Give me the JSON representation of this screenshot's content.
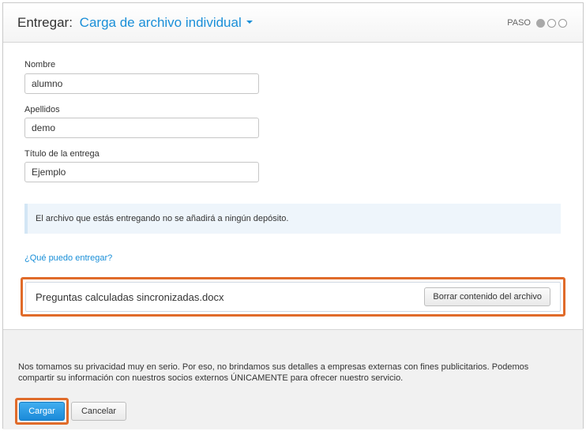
{
  "header": {
    "title_prefix": "Entregar:",
    "mode_label": "Carga de archivo individual",
    "step_label": "PASO",
    "steps_total": 3,
    "current_step": 1
  },
  "form": {
    "first_name": {
      "label": "Nombre",
      "value": "alumno"
    },
    "last_name": {
      "label": "Apellidos",
      "value": "demo"
    },
    "submission_title": {
      "label": "Título de la entrega",
      "value": "Ejemplo"
    }
  },
  "info_message": "El archivo que estás entregando no se añadirá a ningún depósito.",
  "help_link": "¿Qué puedo entregar?",
  "file": {
    "name": "Preguntas calculadas sincronizadas.docx",
    "clear_label": "Borrar contenido del archivo"
  },
  "footer": {
    "privacy_text": "Nos tomamos su privacidad muy en serio. Por eso, no brindamos sus detalles a empresas externas con fines publicitarios. Podemos compartir su información con nuestros socios externos ÚNICAMENTE para ofrecer nuestro servicio.",
    "upload_label": "Cargar",
    "cancel_label": "Cancelar"
  },
  "colors": {
    "accent": "#1a8fd8",
    "highlight": "#e06b2a",
    "info_background": "#eef5fb"
  }
}
